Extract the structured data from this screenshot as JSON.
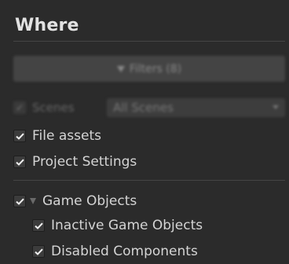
{
  "section": {
    "title": "Where"
  },
  "filters_button": {
    "label": "Filters (8)",
    "icon": "funnel-icon"
  },
  "scenes": {
    "label": "Scenes",
    "checked": true,
    "dropdown_value": "All Scenes"
  },
  "options": [
    {
      "label": "File assets",
      "checked": true
    },
    {
      "label": "Project Settings",
      "checked": true
    }
  ],
  "game_objects": {
    "label": "Game Objects",
    "checked": true,
    "expanded": true,
    "children": [
      {
        "label": "Inactive Game Objects",
        "checked": true
      },
      {
        "label": "Disabled Components",
        "checked": true
      }
    ]
  }
}
